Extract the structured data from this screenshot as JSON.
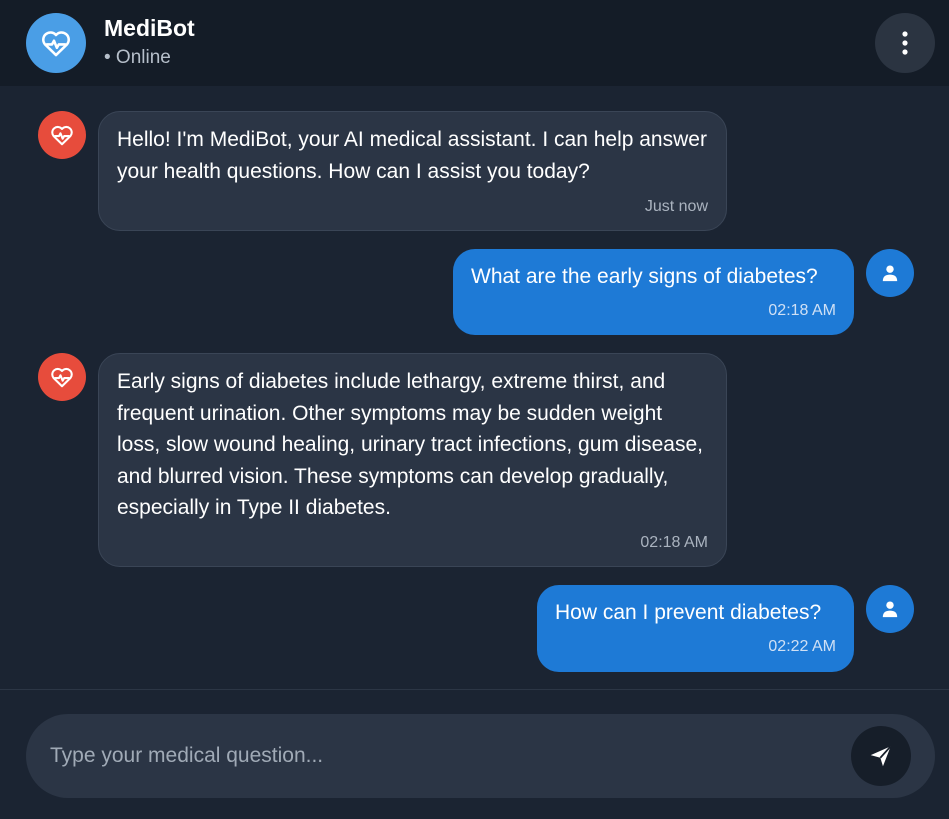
{
  "header": {
    "avatar_icon": "heart-pulse-icon",
    "title": "MediBot",
    "status": "• Online",
    "menu_icon": "vertical-dots-icon"
  },
  "messages": [
    {
      "sender": "bot",
      "avatar_icon": "heart-pulse-icon",
      "text": "Hello! I'm MediBot, your AI medical assistant. I can help answer your health questions. How can I assist you today?",
      "time": "Just now"
    },
    {
      "sender": "user",
      "avatar_icon": "user-icon",
      "text": "What are the early signs of diabetes?",
      "time": "02:18 AM"
    },
    {
      "sender": "bot",
      "avatar_icon": "heart-pulse-icon",
      "text": "Early signs of diabetes include lethargy, extreme thirst, and frequent urination. Other symptoms may be sudden weight loss, slow wound healing, urinary tract infections, gum disease, and blurred vision. These symptoms can develop gradually, especially in Type II diabetes.",
      "time": "02:18 AM"
    },
    {
      "sender": "user",
      "avatar_icon": "user-icon",
      "text": "How can I prevent diabetes?",
      "time": "02:22 AM"
    }
  ],
  "composer": {
    "placeholder": "Type your medical question...",
    "value": "",
    "send_icon": "send-icon"
  },
  "colors": {
    "background": "#1b2432",
    "header": "#141c27",
    "bot_bubble": "#2b3545",
    "user_bubble": "#1e7ad6",
    "bot_avatar": "#e74c3c",
    "brand_avatar": "#4a9ee6"
  }
}
